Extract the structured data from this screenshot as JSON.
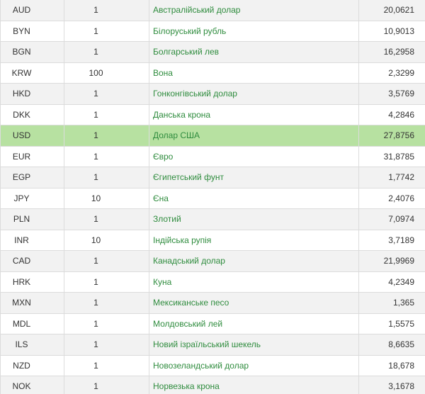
{
  "rates": {
    "rows": [
      {
        "code": "AUD",
        "units": "1",
        "name": "Австралійський долар",
        "rate": "20,0621"
      },
      {
        "code": "BYN",
        "units": "1",
        "name": "Білоруський рубль",
        "rate": "10,9013"
      },
      {
        "code": "BGN",
        "units": "1",
        "name": "Болгарський лев",
        "rate": "16,2958"
      },
      {
        "code": "KRW",
        "units": "100",
        "name": "Вона",
        "rate": "2,3299"
      },
      {
        "code": "HKD",
        "units": "1",
        "name": "Гонконгівський долар",
        "rate": "3,5769"
      },
      {
        "code": "DKK",
        "units": "1",
        "name": "Данська крона",
        "rate": "4,2846"
      },
      {
        "code": "USD",
        "units": "1",
        "name": "Долар США",
        "rate": "27,8756"
      },
      {
        "code": "EUR",
        "units": "1",
        "name": "Євро",
        "rate": "31,8785"
      },
      {
        "code": "EGP",
        "units": "1",
        "name": "Єгипетський фунт",
        "rate": "1,7742"
      },
      {
        "code": "JPY",
        "units": "10",
        "name": "Єна",
        "rate": "2,4076"
      },
      {
        "code": "PLN",
        "units": "1",
        "name": "Злотий",
        "rate": "7,0974"
      },
      {
        "code": "INR",
        "units": "10",
        "name": "Індійська рупія",
        "rate": "3,7189"
      },
      {
        "code": "CAD",
        "units": "1",
        "name": "Канадський долар",
        "rate": "21,9969"
      },
      {
        "code": "HRK",
        "units": "1",
        "name": "Куна",
        "rate": "4,2349"
      },
      {
        "code": "MXN",
        "units": "1",
        "name": "Мексиканське песо",
        "rate": "1,365"
      },
      {
        "code": "MDL",
        "units": "1",
        "name": "Молдовський лей",
        "rate": "1,5575"
      },
      {
        "code": "ILS",
        "units": "1",
        "name": "Новий ізраїльський шекель",
        "rate": "8,6635"
      },
      {
        "code": "NZD",
        "units": "1",
        "name": "Новозеландський долар",
        "rate": "18,678"
      },
      {
        "code": "NOK",
        "units": "1",
        "name": "Норвезька крона",
        "rate": "3,1678"
      }
    ],
    "highlight_color": "#b7e1a1",
    "link_color": "#2f8c3e"
  }
}
